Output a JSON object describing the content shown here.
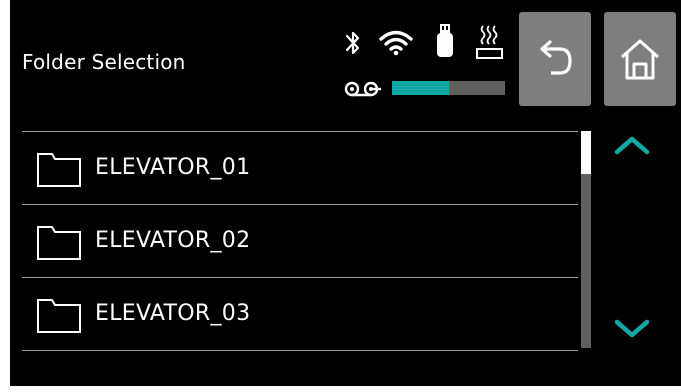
{
  "header": {
    "title": "Folder Selection"
  },
  "status": {
    "icons": [
      "bluetooth-icon",
      "wifi-icon",
      "usb-drive-icon",
      "heater-icon",
      "tape-reel-icon"
    ],
    "tape_level_fraction": 0.5
  },
  "nav": {
    "back_icon": "back-arrow-icon",
    "home_icon": "home-icon"
  },
  "folders": [
    {
      "label": "ELEVATOR_01"
    },
    {
      "label": "ELEVATOR_02"
    },
    {
      "label": "ELEVATOR_03"
    }
  ],
  "scroll": {
    "up_icon": "chevron-up-icon",
    "down_icon": "chevron-down-icon"
  },
  "colors": {
    "background": "#000000",
    "text": "#ffffff",
    "button": "#7e7e7e",
    "accent": "#12a8a4",
    "track": "#5f5f5f",
    "divider": "#9a9a9a"
  }
}
